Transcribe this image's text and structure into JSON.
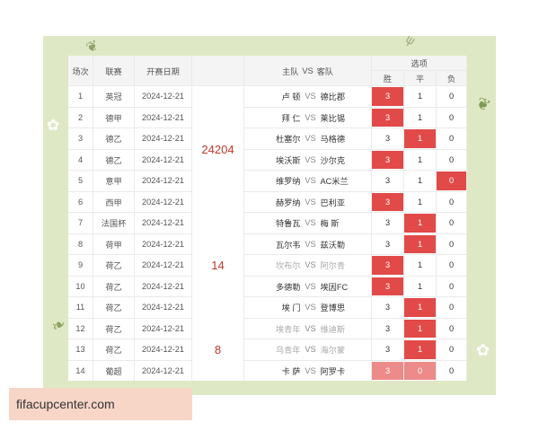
{
  "decor": {
    "sprout_tl": "❦",
    "flower_l": "✿",
    "leaf_l": "❧",
    "leaf_r": "❦",
    "flower_r": "✿",
    "sprout_tr": "ψ"
  },
  "table": {
    "headers": {
      "round": "场次",
      "league": "联赛",
      "date": "开赛日期",
      "match_home": "主队",
      "match_vs": "VS",
      "match_away": "客队",
      "options": "选项",
      "win": "胜",
      "draw": "平",
      "loss": "负"
    },
    "groups": [
      "24204",
      "14",
      "8"
    ],
    "rows": [
      {
        "no": "1",
        "league": "英冠",
        "date": "2024-12-21",
        "home": "卢 顿",
        "vs": "VS",
        "away": "德比郡",
        "w": "3",
        "d": "1",
        "l": "0",
        "sel": "w",
        "faded": false
      },
      {
        "no": "2",
        "league": "德甲",
        "date": "2024-12-21",
        "home": "拜 仁",
        "vs": "VS",
        "away": "莱比锡",
        "w": "3",
        "d": "1",
        "l": "0",
        "sel": "w",
        "faded": false
      },
      {
        "no": "3",
        "league": "德乙",
        "date": "2024-12-21",
        "home": "杜塞尔",
        "vs": "VS",
        "away": "马格德",
        "w": "3",
        "d": "1",
        "l": "0",
        "sel": "d",
        "faded": false
      },
      {
        "no": "4",
        "league": "德乙",
        "date": "2024-12-21",
        "home": "埃沃斯",
        "vs": "VS",
        "away": "沙尔克",
        "w": "3",
        "d": "1",
        "l": "0",
        "sel": "w",
        "faded": false
      },
      {
        "no": "5",
        "league": "意甲",
        "date": "2024-12-21",
        "home": "维罗纳",
        "vs": "VS",
        "away": "AC米兰",
        "w": "3",
        "d": "1",
        "l": "0",
        "sel": "l",
        "faded": false
      },
      {
        "no": "6",
        "league": "西甲",
        "date": "2024-12-21",
        "home": "赫罗纳",
        "vs": "VS",
        "away": "巴利亚",
        "w": "3",
        "d": "1",
        "l": "0",
        "sel": "w",
        "faded": false
      },
      {
        "no": "7",
        "league": "法国杯",
        "date": "2024-12-21",
        "home": "特鲁瓦",
        "vs": "VS",
        "away": "梅 斯",
        "w": "3",
        "d": "1",
        "l": "0",
        "sel": "d",
        "faded": false
      },
      {
        "no": "8",
        "league": "荷甲",
        "date": "2024-12-21",
        "home": "瓦尔韦",
        "vs": "VS",
        "away": "兹沃勒",
        "w": "3",
        "d": "1",
        "l": "0",
        "sel": "d",
        "faded": false
      },
      {
        "no": "9",
        "league": "荷乙",
        "date": "2024-12-21",
        "home": "坎布尔",
        "vs": "VS",
        "away": "阿尔青",
        "w": "3",
        "d": "1",
        "l": "0",
        "sel": "w",
        "faded": true
      },
      {
        "no": "10",
        "league": "荷乙",
        "date": "2024-12-21",
        "home": "多德勒",
        "vs": "VS",
        "away": "埃因FC",
        "w": "3",
        "d": "1",
        "l": "0",
        "sel": "w",
        "faded": false
      },
      {
        "no": "11",
        "league": "荷乙",
        "date": "2024-12-21",
        "home": "埃 门",
        "vs": "VS",
        "away": "登博思",
        "w": "3",
        "d": "1",
        "l": "0",
        "sel": "d",
        "faded": false
      },
      {
        "no": "12",
        "league": "荷乙",
        "date": "2024-12-21",
        "home": "埃青年",
        "vs": "VS",
        "away": "维迪斯",
        "w": "3",
        "d": "1",
        "l": "0",
        "sel": "d",
        "faded": true
      },
      {
        "no": "13",
        "league": "荷乙",
        "date": "2024-12-21",
        "home": "乌青年",
        "vs": "VS",
        "away": "海尔蒙",
        "w": "3",
        "d": "1",
        "l": "0",
        "sel": "d",
        "faded": true
      },
      {
        "no": "14",
        "league": "葡超",
        "date": "2024-12-21",
        "home": "卡 萨",
        "vs": "VS",
        "away": "阿罗卡",
        "w": "3",
        "d": "0",
        "l": "0",
        "sel": "wd",
        "faded": false
      }
    ]
  },
  "watermark": "fifacupcenter.com",
  "colors": {
    "selected": "#e14a49",
    "group_number": "#c0392b",
    "backdrop": "#dfe8c4"
  }
}
